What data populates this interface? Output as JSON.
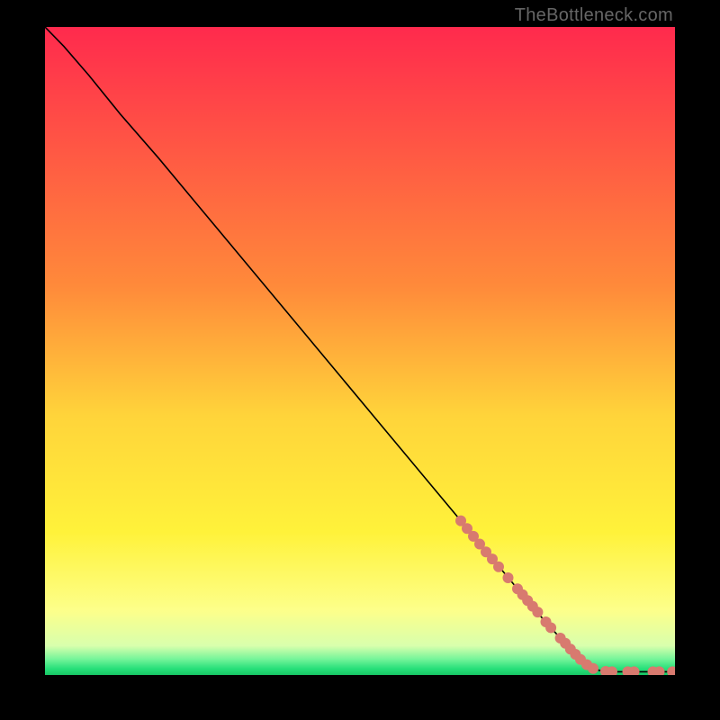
{
  "watermark": "TheBottleneck.com",
  "chart_data": {
    "type": "line",
    "title": "",
    "xlabel": "",
    "ylabel": "",
    "xlim": [
      0,
      100
    ],
    "ylim": [
      0,
      100
    ],
    "grid": false,
    "legend": false,
    "background_gradient": {
      "stops": [
        {
          "offset": 0.0,
          "color": "#ff2a4d"
        },
        {
          "offset": 0.4,
          "color": "#ff8a3a"
        },
        {
          "offset": 0.6,
          "color": "#ffd43a"
        },
        {
          "offset": 0.78,
          "color": "#fff23a"
        },
        {
          "offset": 0.9,
          "color": "#fdff8a"
        },
        {
          "offset": 0.955,
          "color": "#d8ffad"
        },
        {
          "offset": 0.975,
          "color": "#77f59a"
        },
        {
          "offset": 0.99,
          "color": "#28e07a"
        },
        {
          "offset": 1.0,
          "color": "#17c765"
        }
      ]
    },
    "series": [
      {
        "name": "curve",
        "color": "#000000",
        "width": 1.6,
        "points": [
          {
            "x": 0.0,
            "y": 100.0
          },
          {
            "x": 3.0,
            "y": 97.0
          },
          {
            "x": 7.0,
            "y": 92.5
          },
          {
            "x": 12.0,
            "y": 86.5
          },
          {
            "x": 18.0,
            "y": 79.8
          },
          {
            "x": 24.0,
            "y": 72.8
          },
          {
            "x": 30.0,
            "y": 65.8
          },
          {
            "x": 36.0,
            "y": 58.8
          },
          {
            "x": 42.0,
            "y": 51.8
          },
          {
            "x": 48.0,
            "y": 44.8
          },
          {
            "x": 54.0,
            "y": 37.8
          },
          {
            "x": 60.0,
            "y": 30.8
          },
          {
            "x": 66.0,
            "y": 23.8
          },
          {
            "x": 72.0,
            "y": 16.8
          },
          {
            "x": 78.0,
            "y": 9.8
          },
          {
            "x": 84.0,
            "y": 3.3
          },
          {
            "x": 86.5,
            "y": 1.3
          },
          {
            "x": 88.0,
            "y": 0.7
          },
          {
            "x": 89.5,
            "y": 0.5
          },
          {
            "x": 100.0,
            "y": 0.5
          }
        ]
      }
    ],
    "markers": {
      "color": "#d87a6f",
      "radius": 6,
      "points": [
        {
          "x": 66.0,
          "y": 23.8
        },
        {
          "x": 67.0,
          "y": 22.6
        },
        {
          "x": 68.0,
          "y": 21.4
        },
        {
          "x": 69.0,
          "y": 20.2
        },
        {
          "x": 70.0,
          "y": 19.0
        },
        {
          "x": 71.0,
          "y": 17.9
        },
        {
          "x": 72.0,
          "y": 16.7
        },
        {
          "x": 73.5,
          "y": 15.0
        },
        {
          "x": 75.0,
          "y": 13.3
        },
        {
          "x": 75.8,
          "y": 12.4
        },
        {
          "x": 76.6,
          "y": 11.5
        },
        {
          "x": 77.4,
          "y": 10.6
        },
        {
          "x": 78.2,
          "y": 9.7
        },
        {
          "x": 79.5,
          "y": 8.2
        },
        {
          "x": 80.3,
          "y": 7.3
        },
        {
          "x": 81.8,
          "y": 5.7
        },
        {
          "x": 82.6,
          "y": 4.9
        },
        {
          "x": 83.4,
          "y": 4.0
        },
        {
          "x": 84.2,
          "y": 3.2
        },
        {
          "x": 85.0,
          "y": 2.4
        },
        {
          "x": 86.0,
          "y": 1.6
        },
        {
          "x": 87.0,
          "y": 1.0
        },
        {
          "x": 89.0,
          "y": 0.55
        },
        {
          "x": 90.0,
          "y": 0.5
        },
        {
          "x": 92.5,
          "y": 0.5
        },
        {
          "x": 93.5,
          "y": 0.5
        },
        {
          "x": 96.5,
          "y": 0.5
        },
        {
          "x": 97.5,
          "y": 0.5
        },
        {
          "x": 99.6,
          "y": 0.5
        }
      ]
    }
  }
}
